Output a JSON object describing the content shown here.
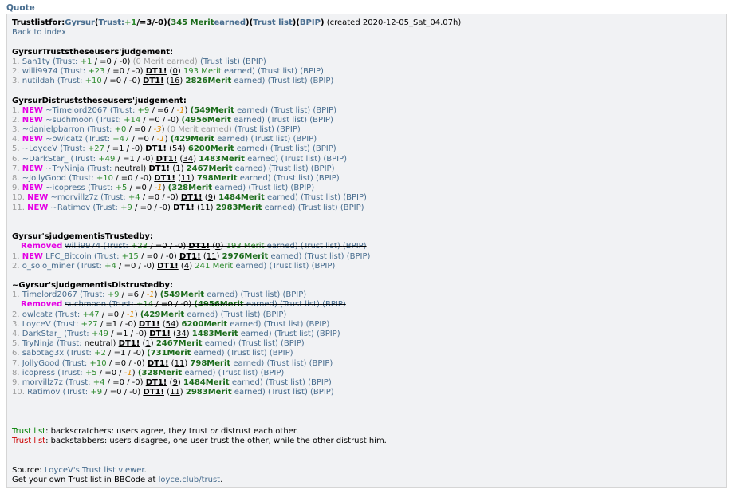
{
  "quote_label": "Quote",
  "header": {
    "prefix": "Trustlistfor:",
    "user": "Gyrsur",
    "trust_open": "(",
    "trust_label": "Trust:",
    "trust_plus": "+1",
    "trust_rest": "/=3/-0)",
    "merit_open": "(",
    "merit_num": "345 Merit",
    "merit_word": "earned",
    "merit_close": ")",
    "trustlist_open": "(",
    "trustlist": "Trust list",
    "trustlist_close": ")",
    "bpip_open": "(",
    "bpip": "BPIP",
    "bpip_close": ")",
    "created": " (created 2020-12-05_Sat_04.07h)",
    "back": "Back to index"
  },
  "sections": {
    "trusts_title": "GyrsurTruststheseusers'judgement:",
    "distrusts_title": "GyrsurDistruststheseusers'judgement:",
    "trusted_by_title": "Gyrsur'sjudgementisTrustedby:",
    "distrusted_by_title": "~Gyrsur'sjudgementisDistrustedby:"
  },
  "trusts": [
    {
      "num": "1.",
      "name": "San1ty",
      "trust_label": "(Trust:",
      "plus": "+1",
      "rest": "/ =0 / -0)",
      "merit_grey": "(0 Merit earned)",
      "tl": "(Trust list)",
      "bp": "(BPIP)"
    },
    {
      "num": "2.",
      "name": "willi9974",
      "trust_label": "(Trust:",
      "plus": "+23",
      "rest": "/ =0 / -0)",
      "dt": "DT1!",
      "dtn": "0",
      "merit_g": "193 Merit",
      "merit_e": "earned)",
      "tl": "(Trust list)",
      "bp": "(BPIP)"
    },
    {
      "num": "3.",
      "name": "nutildah",
      "trust_label": "(Trust:",
      "plus": "+10",
      "rest": "/ =0 / -0)",
      "dt": "DT1!",
      "dtn": "16",
      "merit_b": "2826Merit",
      "merit_e": "earned)",
      "tl": "(Trust list)",
      "bp": "(BPIP)"
    }
  ],
  "distrusts": [
    {
      "num": "1.",
      "new": "NEW",
      "name": "~Timelord2067",
      "tr": "(Trust:",
      "plus": "+9",
      "rest": "/ =6 /",
      "neg": "-1",
      "close": ")",
      "mb": "(549Merit",
      "me": "earned)",
      "tl": "(Trust list)",
      "bp": "(BPIP)"
    },
    {
      "num": "2.",
      "new": "NEW",
      "name": "~suchmoon",
      "tr": "(Trust:",
      "plus": "+14",
      "rest": "/ =0 / -0)",
      "mb": "(4956Merit",
      "me": "earned)",
      "tl": "(Trust list)",
      "bp": "(BPIP)"
    },
    {
      "num": "3.",
      "name": "~danielpbarron",
      "tr": "(Trust:",
      "plus": "+0",
      "rest": "/ =0 /",
      "neg": "-3",
      "close": ")",
      "mg": "(0 Merit earned)",
      "tl": "(Trust list)",
      "bp": "(BPIP)"
    },
    {
      "num": "4.",
      "new": "NEW",
      "name": "~owlcatz",
      "tr": "(Trust:",
      "plus": "+47",
      "rest": "/ =0 /",
      "neg": "-1",
      "close": ")",
      "mb": "(429Merit",
      "me": "earned)",
      "tl": "(Trust list)",
      "bp": "(BPIP)"
    },
    {
      "num": "5.",
      "name": "~LoyceV",
      "tr": "(Trust:",
      "plus": "+27",
      "rest": "/ =1 / -0)",
      "dt": "DT1!",
      "dtn": "54",
      "mb": "6200Merit",
      "me": "earned)",
      "tl": "(Trust list)",
      "bp": "(BPIP)"
    },
    {
      "num": "6.",
      "name": "~DarkStar_",
      "tr": "(Trust:",
      "plus": "+49",
      "rest": "/ =1 / -0)",
      "dt": "DT1!",
      "dtn": "34",
      "mb": "1483Merit",
      "me": "earned)",
      "tl": "(Trust list)",
      "bp": "(BPIP)"
    },
    {
      "num": "7.",
      "new": "NEW",
      "name": "~TryNinja",
      "tr": "(Trust:",
      "rest": "neutral)",
      "dt": "DT1!",
      "dtn": "1",
      "mb": "2467Merit",
      "me": "earned)",
      "tl": "(Trust list)",
      "bp": "(BPIP)"
    },
    {
      "num": "8.",
      "name": "~JollyGood",
      "tr": "(Trust:",
      "plus": "+10",
      "rest": "/ =0 / -0)",
      "dt": "DT1!",
      "dtn": "11",
      "mb": "798Merit",
      "me": "earned)",
      "tl": "(Trust list)",
      "bp": "(BPIP)"
    },
    {
      "num": "9.",
      "new": "NEW",
      "name": "~icopress",
      "tr": "(Trust:",
      "plus": "+5",
      "rest": "/ =0 /",
      "neg": "-1",
      "close": ")",
      "mb": "(328Merit",
      "me": "earned)",
      "tl": "(Trust list)",
      "bp": "(BPIP)"
    },
    {
      "num": "10.",
      "new": "NEW",
      "name": "~morvillz7z",
      "tr": "(Trust:",
      "plus": "+4",
      "rest": "/ =0 / -0)",
      "dt": "DT1!",
      "dtn": "9",
      "mb": "1484Merit",
      "me": "earned)",
      "tl": "(Trust list)",
      "bp": "(BPIP)"
    },
    {
      "num": "11.",
      "new": "NEW",
      "name": "~Ratimov",
      "tr": "(Trust:",
      "plus": "+9",
      "rest": "/ =0 / -0)",
      "dt": "DT1!",
      "dtn": "11",
      "mb": "2983Merit",
      "me": "earned)",
      "tl": "(Trust list)",
      "bp": "(BPIP)"
    }
  ],
  "trusted_by": [
    {
      "removed": "Removed",
      "name": "willi9974",
      "tr": "(Trust:",
      "plus": "+23",
      "rest": "/ =0 / -0)",
      "dt": "DT1!",
      "dtn": "0",
      "mg": "193 Merit",
      "me": "earned)",
      "tl": "(Trust list)",
      "bp": "(BPIP)"
    },
    {
      "num": "1.",
      "new": "NEW",
      "name": "LFC_Bitcoin",
      "tr": "(Trust:",
      "plus": "+15",
      "rest": "/ =0 / -0)",
      "dt": "DT1!",
      "dtn": "11",
      "mb": "2976Merit",
      "me": "earned)",
      "tl": "(Trust list)",
      "bp": "(BPIP)"
    },
    {
      "num": "2.",
      "name": "o_solo_miner",
      "tr": "(Trust:",
      "plus": "+4",
      "rest": "/ =0 / -0)",
      "dt": "DT1!",
      "dtn": "4",
      "mg": "241 Merit",
      "me": "earned)",
      "tl": "(Trust list)",
      "bp": "(BPIP)"
    }
  ],
  "distrusted_by": [
    {
      "num": "1.",
      "name": "Timelord2067",
      "tr": "(Trust:",
      "plus": "+9",
      "rest": "/ =6 /",
      "neg": "-1",
      "close": ")",
      "mb": "(549Merit",
      "me": "earned)",
      "tl": "(Trust list)",
      "bp": "(BPIP)"
    },
    {
      "removed": "Removed",
      "name": "suchmoon",
      "tr": "(Trust:",
      "plus": "+14",
      "rest": "/ =0 / -0)",
      "mb": "(4956Merit",
      "me": "earned)",
      "tl": "(Trust list)",
      "bp": "(BPIP)"
    },
    {
      "num": "2.",
      "name": "owlcatz",
      "tr": "(Trust:",
      "plus": "+47",
      "rest": "/ =0 /",
      "neg": "-1",
      "close": ")",
      "mb": "(429Merit",
      "me": "earned)",
      "tl": "(Trust list)",
      "bp": "(BPIP)"
    },
    {
      "num": "3.",
      "name": "LoyceV",
      "tr": "(Trust:",
      "plus": "+27",
      "rest": "/ =1 / -0)",
      "dt": "DT1!",
      "dtn": "54",
      "mb": "6200Merit",
      "me": "earned)",
      "tl": "(Trust list)",
      "bp": "(BPIP)"
    },
    {
      "num": "4.",
      "name": "DarkStar_",
      "tr": "(Trust:",
      "plus": "+49",
      "rest": "/ =1 / -0)",
      "dt": "DT1!",
      "dtn": "34",
      "mb": "1483Merit",
      "me": "earned)",
      "tl": "(Trust list)",
      "bp": "(BPIP)"
    },
    {
      "num": "5.",
      "name": "TryNinja",
      "tr": "(Trust:",
      "rest": "neutral)",
      "dt": "DT1!",
      "dtn": "1",
      "mb": "2467Merit",
      "me": "earned)",
      "tl": "(Trust list)",
      "bp": "(BPIP)"
    },
    {
      "num": "6.",
      "name": "sabotag3x",
      "tr": "(Trust:",
      "plus": "+2",
      "rest": "/ =1 / -0)",
      "mb": "(731Merit",
      "me": "earned)",
      "tl": "(Trust list)",
      "bp": "(BPIP)"
    },
    {
      "num": "7.",
      "name": "JollyGood",
      "tr": "(Trust:",
      "plus": "+10",
      "rest": "/ =0 / -0)",
      "dt": "DT1!",
      "dtn": "11",
      "mb": "798Merit",
      "me": "earned)",
      "tl": "(Trust list)",
      "bp": "(BPIP)"
    },
    {
      "num": "8.",
      "name": "icopress",
      "tr": "(Trust:",
      "plus": "+5",
      "rest": "/ =0 /",
      "neg": "-1",
      "close": ")",
      "mb": "(328Merit",
      "me": "earned)",
      "tl": "(Trust list)",
      "bp": "(BPIP)"
    },
    {
      "num": "9.",
      "name": "morvillz7z",
      "tr": "(Trust:",
      "plus": "+4",
      "rest": "/ =0 / -0)",
      "dt": "DT1!",
      "dtn": "9",
      "mb": "1484Merit",
      "me": "earned)",
      "tl": "(Trust list)",
      "bp": "(BPIP)"
    },
    {
      "num": "10.",
      "name": "Ratimov",
      "tr": "(Trust:",
      "plus": "+9",
      "rest": "/ =0 / -0)",
      "dt": "DT1!",
      "dtn": "11",
      "mb": "2983Merit",
      "me": "earned)",
      "tl": "(Trust list)",
      "bp": "(BPIP)"
    }
  ],
  "legend": {
    "green_label": "Trust list",
    "green_text": ": backscratchers: users agree, they trust ",
    "green_or": "or",
    "green_tail": " distrust each other.",
    "red_label": "Trust list",
    "red_text": ": backstabbers: users disagree, one user trust the other, while the other distrust him."
  },
  "footer": {
    "source_label": "Source: ",
    "source_link": "LoyceV's Trust list viewer",
    "source_end": ".",
    "get_text": "Get your own Trust list in BBCode at ",
    "get_link": "loyce.club/trust",
    "get_end": "."
  }
}
